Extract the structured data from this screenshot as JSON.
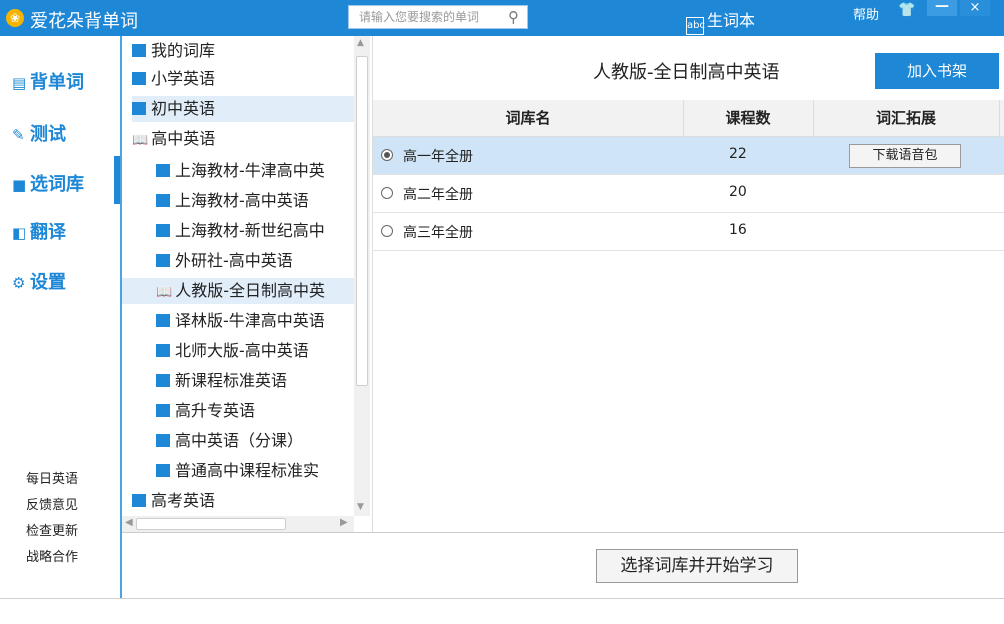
{
  "titlebar": {
    "app_name": "爱花朵背单词",
    "search_placeholder": "请输入您要搜索的单词",
    "vocab_label": "生词本",
    "help_label": "帮助",
    "minimize": "—",
    "close": "×"
  },
  "nav": {
    "items": [
      {
        "label": "背单词",
        "icon": "book-icon"
      },
      {
        "label": "测试",
        "icon": "edit-icon"
      },
      {
        "label": "选词库",
        "icon": "library-icon"
      },
      {
        "label": "翻译",
        "icon": "translate-icon"
      },
      {
        "label": "设置",
        "icon": "gear-icon"
      }
    ],
    "selected": "选词库",
    "footer_links": [
      "每日英语",
      "反馈意见",
      "检查更新",
      "战略合作"
    ]
  },
  "tree": {
    "items": [
      {
        "label": "我的词库",
        "level": 0
      },
      {
        "label": "小学英语",
        "level": 0
      },
      {
        "label": "初中英语",
        "level": 0
      },
      {
        "label": "高中英语",
        "level": 0,
        "open": true
      },
      {
        "label": "上海教材-牛津高中英",
        "level": 1
      },
      {
        "label": "上海教材-高中英语",
        "level": 1
      },
      {
        "label": "上海教材-新世纪高中",
        "level": 1
      },
      {
        "label": "外研社-高中英语",
        "level": 1
      },
      {
        "label": "人教版-全日制高中英",
        "level": 1,
        "selected": true
      },
      {
        "label": "译林版-牛津高中英语",
        "level": 1
      },
      {
        "label": "北师大版-高中英语",
        "level": 1
      },
      {
        "label": "新课程标准英语",
        "level": 1
      },
      {
        "label": "高升专英语",
        "level": 1
      },
      {
        "label": "高中英语（分课）",
        "level": 1
      },
      {
        "label": "普通高中课程标准实",
        "level": 1
      },
      {
        "label": "高考英语",
        "level": 0
      }
    ]
  },
  "main": {
    "title": "人教版-全日制高中英语",
    "add_shelf_label": "加入书架",
    "columns": [
      "词库名",
      "课程数",
      "词汇拓展"
    ],
    "rows": [
      {
        "name": "高一年全册",
        "count": "22",
        "action": "下载语音包",
        "selected": true
      },
      {
        "name": "高二年全册",
        "count": "20",
        "action": "",
        "selected": false
      },
      {
        "name": "高三年全册",
        "count": "16",
        "action": "",
        "selected": false
      }
    ],
    "start_label": "选择词库并开始学习"
  },
  "colors": {
    "accent": "#1e88d6",
    "selected_row": "#cfe4f7"
  }
}
